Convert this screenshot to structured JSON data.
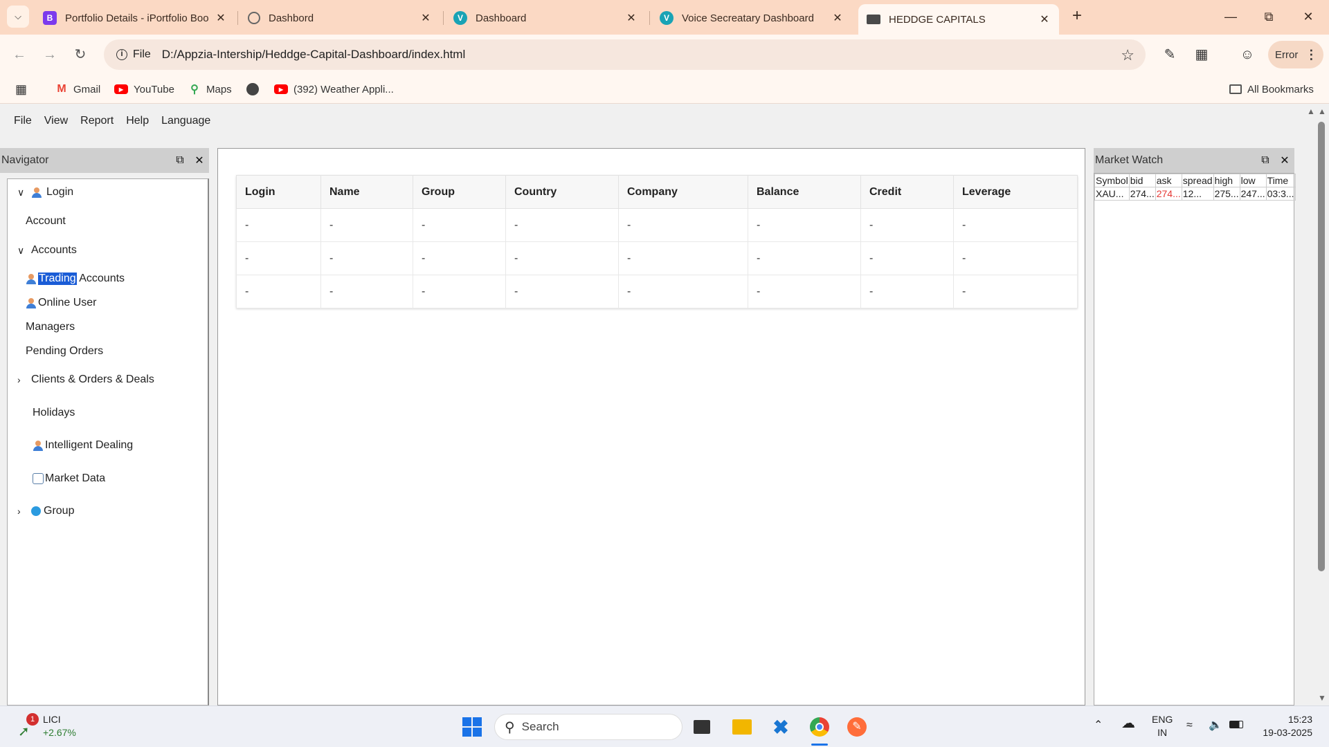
{
  "browser": {
    "tabs": [
      {
        "title": "Portfolio Details - iPortfolio Boo",
        "icon": "bootstrap-icon",
        "color": "#7c3aed",
        "glyph": "B"
      },
      {
        "title": "Dashbord",
        "icon": "globe-icon",
        "color": "#666666",
        "glyph": ""
      },
      {
        "title": "Dashboard",
        "icon": "v-logo-icon",
        "color": "#19a3b5",
        "glyph": "V"
      },
      {
        "title": "Voice Secreatary Dashboard",
        "icon": "v-logo-icon",
        "color": "#19a3b5",
        "glyph": "V"
      },
      {
        "title": "HEDDGE CAPITALS",
        "icon": "flag-icon",
        "color": "#4a4a4a",
        "glyph": ""
      }
    ],
    "active_tab_index": 4,
    "address": {
      "scheme_label": "File",
      "url": "D:/Appzia-Intership/Heddge-Capital-Dashboard/index.html"
    },
    "profile_label": "Error",
    "bookmarks": [
      {
        "label": "Gmail",
        "icon": "gmail-icon",
        "color": "#ea4335"
      },
      {
        "label": "YouTube",
        "icon": "youtube-icon",
        "color": "#ff0000"
      },
      {
        "label": "Maps",
        "icon": "maps-icon",
        "color": "#34a853"
      },
      {
        "label": "",
        "icon": "globe-icon",
        "color": "#444444"
      },
      {
        "label": "(392) Weather Appli...",
        "icon": "youtube-icon",
        "color": "#ff0000"
      }
    ],
    "all_bookmarks_label": "All Bookmarks"
  },
  "menu": [
    "File",
    "View",
    "Report",
    "Help",
    "Language"
  ],
  "navigator": {
    "title": "Navigator",
    "items": {
      "login": "Login",
      "account": "Account",
      "accounts": "Accounts",
      "trading_sel": "Trading",
      "trading_rest": " Accounts",
      "online_user": "Online User",
      "managers": "Managers",
      "pending_orders": "Pending Orders",
      "clients": "Clients & Orders & Deals",
      "holidays": "Holidays",
      "intelligent_dealing": "Intelligent Dealing",
      "market_data": "Market Data",
      "group": "Group"
    }
  },
  "grid": {
    "columns": [
      "Login",
      "Name",
      "Group",
      "Country",
      "Company",
      "Balance",
      "Credit",
      "Leverage"
    ],
    "rows": [
      [
        "-",
        "-",
        "-",
        "-",
        "-",
        "-",
        "-",
        "-"
      ],
      [
        "-",
        "-",
        "-",
        "-",
        "-",
        "-",
        "-",
        "-"
      ],
      [
        "-",
        "-",
        "-",
        "-",
        "-",
        "-",
        "-",
        "-"
      ]
    ]
  },
  "market_watch": {
    "title": "Market Watch",
    "columns": [
      "Symbol",
      "bid",
      "ask",
      "spread",
      "high",
      "low",
      "Time"
    ],
    "row": [
      "XAU...",
      "274...",
      "274...",
      "12...",
      "275...",
      "247...",
      "03:3..."
    ],
    "ask_color": "#e53935"
  },
  "taskbar": {
    "stock_name": "LICI",
    "stock_change": "+2.67%",
    "notification_count": "1",
    "search_placeholder": "Search",
    "lang_top": "ENG",
    "lang_bottom": "IN",
    "time": "15:23",
    "date": "19-03-2025"
  }
}
